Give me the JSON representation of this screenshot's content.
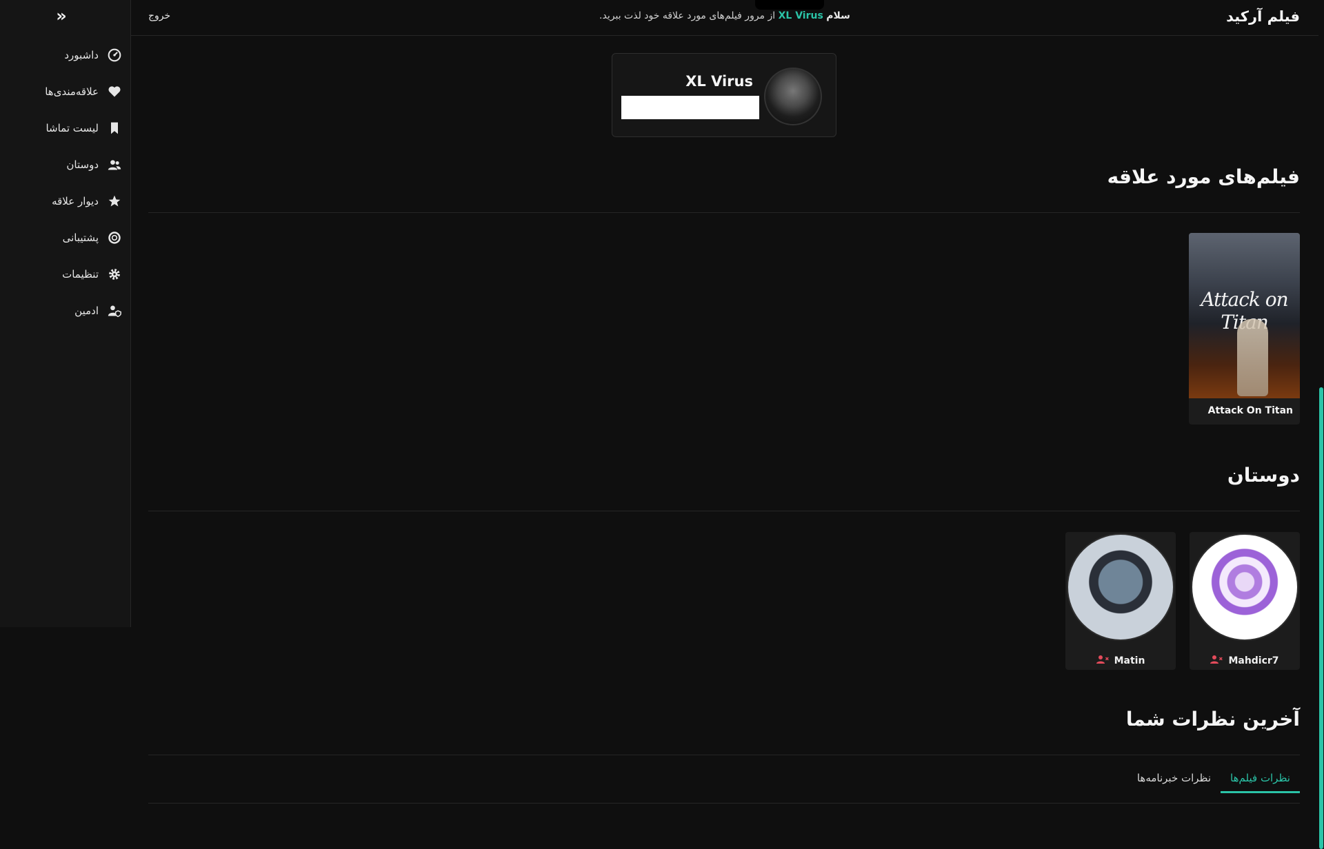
{
  "sidebar": {
    "collapse_icon": "double-chevron-right-icon",
    "items": [
      {
        "label": "داشبورد",
        "icon": "dashboard-icon"
      },
      {
        "label": "علاقه‌مندی‌ها",
        "icon": "heart-icon"
      },
      {
        "label": "لیست تماشا",
        "icon": "bookmark-icon"
      },
      {
        "label": "دوستان",
        "icon": "users-icon"
      },
      {
        "label": "دیوار علاقه",
        "icon": "star-icon"
      },
      {
        "label": "پشتیبانی",
        "icon": "lifebuoy-icon"
      },
      {
        "label": "تنظیمات",
        "icon": "gear-icon"
      },
      {
        "label": "ادمین",
        "icon": "user-shield-icon"
      }
    ]
  },
  "header": {
    "brand": "فیلم آرکید",
    "greeting_prefix": "سلام",
    "username": "XL Virus",
    "greeting_suffix": "از مرور فیلم‌های مورد علاقه خود لذت ببرید.",
    "logout": "خروج"
  },
  "profile": {
    "name": "XL Virus"
  },
  "favorites": {
    "title": "فیلم‌های مورد علاقه",
    "movies": [
      {
        "name": "Attack On Titan",
        "poster_text": "Attack on Titan"
      }
    ]
  },
  "friends": {
    "title": "دوستان",
    "items": [
      {
        "name": "Mahdicr7"
      },
      {
        "name": "Matin"
      }
    ]
  },
  "comments": {
    "title": "آخرین نظرات شما",
    "tabs": [
      {
        "label": "نظرات فیلم‌ها",
        "active": true
      },
      {
        "label": "نظرات خبرنامه‌ها",
        "active": false
      }
    ]
  },
  "colors": {
    "accent": "#2bc4a8",
    "background": "#0f0f0f",
    "sidebar": "#151515",
    "unfriend": "#e34b5b"
  }
}
